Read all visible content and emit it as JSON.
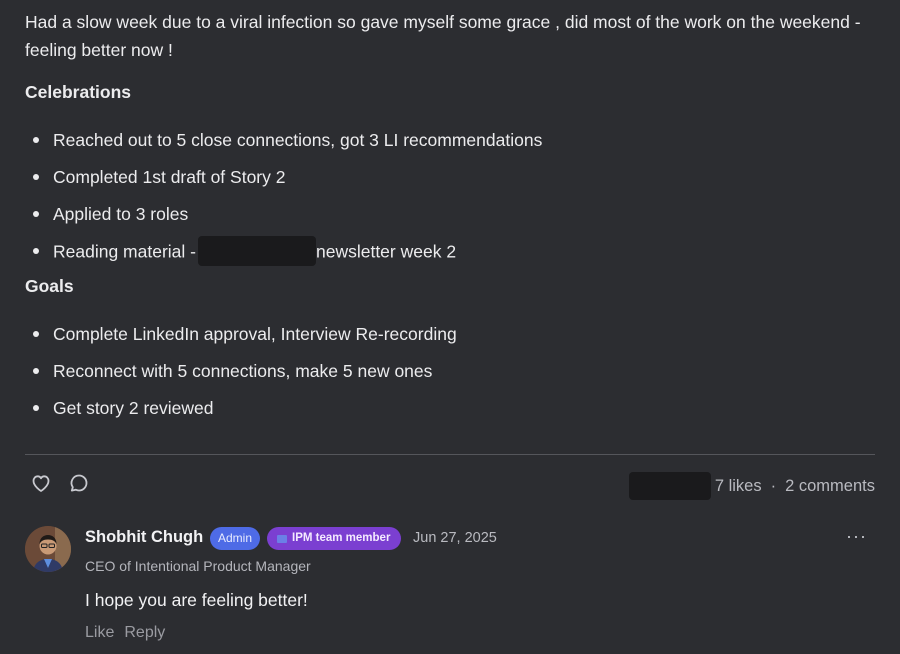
{
  "post": {
    "intro": "Had a slow week due to a viral infection so gave myself some grace , did most of the work on the weekend - feeling better now !",
    "celebrations_heading": "Celebrations",
    "celebrations": [
      "Reached out to 5 close connections, got 3 LI recommendations",
      "Completed 1st draft of Story 2",
      "Applied to 3 roles"
    ],
    "reading_prefix": "Reading material -",
    "reading_suffix": "newsletter week 2",
    "goals_heading": "Goals",
    "goals": [
      "Complete LinkedIn approval, Interview Re-recording",
      "Reconnect with 5 connections, make 5 new ones",
      "Get story 2 reviewed"
    ]
  },
  "actions": {
    "like_icon": "heart-icon",
    "comment_icon": "comment-bubble-icon",
    "likes": "7 likes",
    "separator": "·",
    "comments": "2 comments"
  },
  "comment": {
    "author": "Shobhit Chugh",
    "admin_badge": "Admin",
    "team_badge": "IPM team member",
    "date": "Jun 27, 2025",
    "more": "···",
    "role": "CEO of Intentional Product Manager",
    "text": "I hope you are feeling better!",
    "like_label": "Like",
    "reply_label": "Reply"
  }
}
